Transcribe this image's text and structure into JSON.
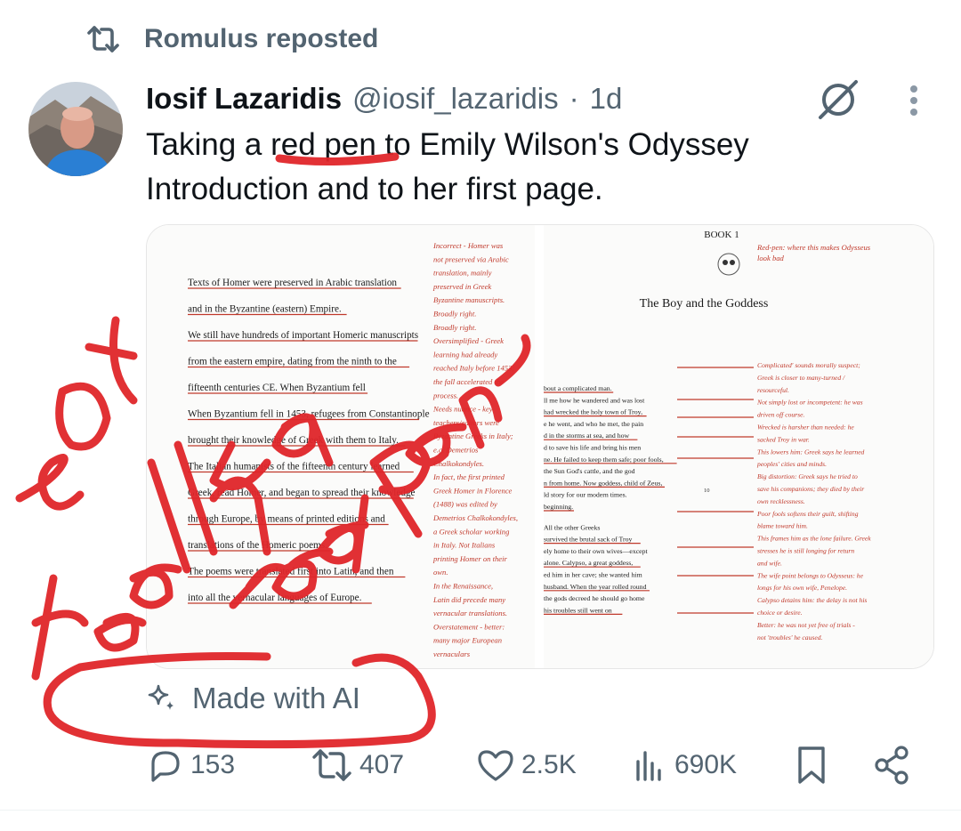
{
  "repost": {
    "label": "Romulus reposted",
    "icon": "repost-icon"
  },
  "tweet": {
    "author_name": "Iosif Lazaridis",
    "handle": "@iosif_lazaridis",
    "separator": "·",
    "time": "1d",
    "text_line1": "Taking a red pen to Emily Wilson's Odyssey",
    "text_line2": "Introduction and to her first page."
  },
  "media": {
    "left_page": {
      "lines": [
        "Texts of Homer were preserved in Arabic translation",
        "and in the Byzantine (eastern) Empire.",
        "We still have hundreds of important Homeric manuscripts",
        "from the eastern empire, dating from the ninth to the",
        "fifteenth centuries CE. When Byzantium fell",
        "When Byzantium fell in 1453, refugees from Constantinople",
        "brought their knowledge of Greek with them to Italy.",
        "The Italian humanists of the fifteenth century learned",
        "Greek, read Homer, and began to spread their knowledge",
        "through Europe, by means of printed editions and",
        "translations of the Homeric poems.",
        "The poems were translated first into Latin, and then",
        "into all the vernacular languages of Europe."
      ],
      "notes": [
        "Incorrect - Homer was",
        "not preserved via Arabic",
        "translation, mainly",
        "preserved in Greek",
        "Byzantine manuscripts.",
        "Broadly right.",
        "Broadly right.",
        "Oversimplified - Greek",
        "learning had already",
        "reached Italy before 1453;",
        "the fall accelerated the",
        "process.",
        "Needs nuance - key",
        "teachers/editors were",
        "Byzantine Greeks in Italy;",
        "e.g. Demetrios",
        "Chalkokondyles.",
        "In fact, the first printed",
        "Greek Homer in Florence",
        "(1488) was edited by",
        "Demetrios Chalkokondyles,",
        "a Greek scholar working",
        "in Italy. Not Italians",
        "printing Homer on their",
        "own.",
        "In the Renaissance,",
        "Latin did precede many",
        "vernacular translations.",
        "Overstatement - better:",
        "many major European",
        "vernaculars"
      ]
    },
    "right_page": {
      "book": "BOOK 1",
      "title": "The Boy and the Goddess",
      "top_note_1": "Red-pen: where this makes Odysseus",
      "top_note_2": "look bad",
      "lines": [
        "bout a complicated man.",
        "ll me how he wandered and was lost",
        "had wrecked the holy town of Troy,",
        "e he went, and who he met, the pain",
        "d in the storms at sea, and how",
        "d to save his life and bring his men",
        "ne. He failed to keep them safe; poor fools,",
        "the Sun God's cattle, and the god",
        "n from home. Now goddess, child of Zeus,",
        "ld story for our modern times.",
        "beginning.",
        "All the other Greeks",
        "survived the brutal sack of Troy",
        "ely home to their own wives—except",
        "alone. Calypso, a great goddess,",
        "ed him in her cave; she wanted him",
        "husband. When the year rolled round",
        "the gods decreed he should go home",
        "his troubles still went on"
      ],
      "line_number": "10",
      "notes": [
        "Complicated' sounds morally suspect;",
        "Greek is closer to many-turned /",
        "resourceful.",
        "Not simply lost or incompetent: he was",
        "driven off course.",
        "Wrecked is harsher than needed: he",
        "sacked Troy in war.",
        "This lowers him: Greek says he learned",
        "peoples' cities and minds.",
        "Big distortion: Greek says he tried to",
        "save his companions; they died by their",
        "own recklessness.",
        "Poor fools softens their guilt, shifting",
        "blame toward him.",
        "This frames him as the lone failure. Greek",
        "stresses he is still longing for return",
        "and wife.",
        "The wife point belongs to Odysseus: he",
        "longs for his own wife, Penelope.",
        "Calypso detains him: the delay is not his",
        "choice or desire.",
        "Better: he was not yet free of trials -",
        "not 'troubles' he caused."
      ]
    },
    "overlay_scribble": "not really a red pen"
  },
  "ai_label": {
    "text": "Made with AI",
    "icon": "sparkle-icon"
  },
  "actions": {
    "replies": "153",
    "reposts": "407",
    "likes": "2.5K",
    "views": "690K"
  },
  "colors": {
    "secondary": "#536471",
    "primary_text": "#0f1419",
    "annotation_red": "#c0392b",
    "scribble_red": "#e0262a"
  }
}
